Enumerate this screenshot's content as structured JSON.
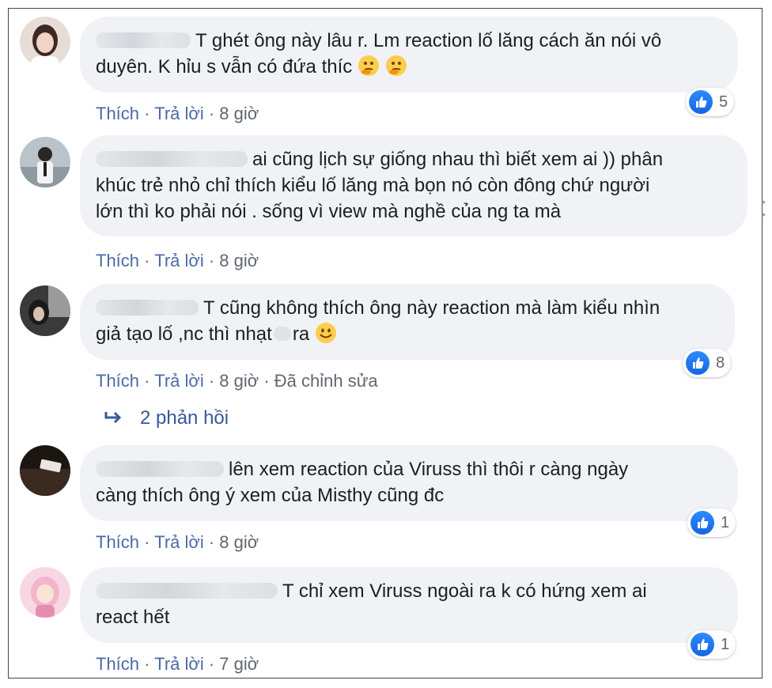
{
  "comments": [
    {
      "text_lines": [
        "T ghét ông này lâu r. Lm reaction lố lăng cách ăn nói vô",
        "duyên. K hỉu s vẫn có đứa thíc"
      ],
      "emoji": "thinking-face",
      "actions": {
        "like": "Thích",
        "reply": "Trả lời",
        "time": "8 giờ",
        "edited": ""
      },
      "reactions": "5"
    },
    {
      "text_lines": [
        "ai cũng lịch sự giống nhau thì biết xem ai )) phân",
        "khúc trẻ nhỏ chỉ thích kiểu lố lăng mà bọn nó còn đông chứ người",
        "lớn thì ko phải nói . sống vì view mà nghề của ng ta mà"
      ],
      "actions": {
        "like": "Thích",
        "reply": "Trả lời",
        "time": "8 giờ",
        "edited": ""
      },
      "reactions": ""
    },
    {
      "text_lines": [
        "T cũng không thích ông này reaction mà làm kiểu nhìn",
        "giả tạo lố ,nc thì nhạt",
        "ra"
      ],
      "emoji": "smiling-face",
      "actions": {
        "like": "Thích",
        "reply": "Trả lời",
        "time": "8 giờ",
        "edited": "Đã chỉnh sửa"
      },
      "reactions": "8"
    },
    {
      "text_lines": [
        "lên xem reaction của Viruss thì thôi r càng ngày",
        "càng thích ông ý xem của Misthy cũng đc"
      ],
      "actions": {
        "like": "Thích",
        "reply": "Trả lời",
        "time": "8 giờ",
        "edited": ""
      },
      "reactions": "1"
    },
    {
      "text_lines": [
        "T chỉ xem Viruss ngoài ra k có hứng xem ai",
        "react hết"
      ],
      "actions": {
        "like": "Thích",
        "reply": "Trả lời",
        "time": "7 giờ",
        "edited": ""
      },
      "reactions": "1"
    }
  ],
  "replies_link": "2 phản hồi",
  "separator": "·",
  "icons": {
    "like": "thumbs-up-icon",
    "reply_arrow": "reply-arrow-icon",
    "more": "more-dots-icon"
  },
  "colors": {
    "link": "#4b6aa6",
    "bubble": "#f0f2f5",
    "like_blue": "#1877f2"
  }
}
